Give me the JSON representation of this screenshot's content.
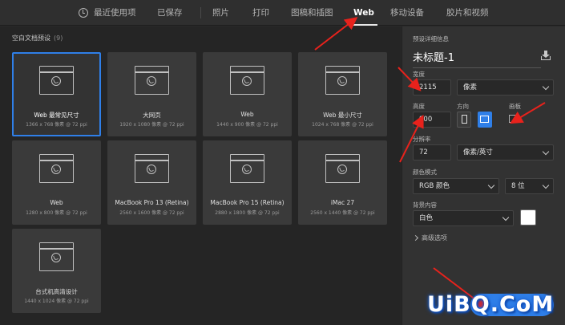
{
  "tabs": [
    {
      "label": "最近使用项",
      "active": false
    },
    {
      "label": "已保存",
      "active": false
    },
    {
      "label": "照片",
      "active": false
    },
    {
      "label": "打印",
      "active": false
    },
    {
      "label": "图稿和插图",
      "active": false
    },
    {
      "label": "Web",
      "active": true
    },
    {
      "label": "移动设备",
      "active": false
    },
    {
      "label": "胶片和视频",
      "active": false
    }
  ],
  "presets": {
    "title": "空白文档预设",
    "count": "(9)",
    "items": [
      {
        "name": "Web 最常见尺寸",
        "size": "1366 x 768 像素 @ 72 ppi",
        "selected": true,
        "icon": "web-globe-icon"
      },
      {
        "name": "大网页",
        "size": "1920 x 1080 像素 @ 72 ppi",
        "selected": false,
        "icon": "web-globe-icon"
      },
      {
        "name": "Web",
        "size": "1440 x 900 像素 @ 72 ppi",
        "selected": false,
        "icon": "web-globe-icon"
      },
      {
        "name": "Web 最小尺寸",
        "size": "1024 x 768 像素 @ 72 ppi",
        "selected": false,
        "icon": "web-globe-icon"
      },
      {
        "name": "Web",
        "size": "1280 x 800 像素 @ 72 ppi",
        "selected": false,
        "icon": "web-globe-icon"
      },
      {
        "name": "MacBook Pro 13 (Retina)",
        "size": "2560 x 1600 像素 @ 72 ppi",
        "selected": false,
        "icon": "web-globe-icon"
      },
      {
        "name": "MacBook Pro 15 (Retina)",
        "size": "2880 x 1800 像素 @ 72 ppi",
        "selected": false,
        "icon": "web-globe-icon"
      },
      {
        "name": "iMac 27",
        "size": "2560 x 1440 像素 @ 72 ppi",
        "selected": false,
        "icon": "web-globe-icon"
      },
      {
        "name": "台式机高清设计",
        "size": "1440 x 1024 像素 @ 72 ppi",
        "selected": false,
        "icon": "web-globe-icon"
      }
    ]
  },
  "details": {
    "heading": "预设详细信息",
    "doc_title": "未标题-1",
    "width_label": "宽度",
    "width_value": "2115",
    "width_unit": "像素",
    "height_label": "高度",
    "height_value": "900",
    "orientation_label": "方向",
    "artboard_label": "画板",
    "resolution_label": "分辨率",
    "resolution_value": "72",
    "resolution_unit": "像素/英寸",
    "color_mode_label": "颜色模式",
    "color_mode_value": "RGB 颜色",
    "bit_depth_value": "8 位",
    "background_label": "背景内容",
    "background_value": "白色",
    "background_swatch": "#ffffff",
    "advanced_label": "高级选项"
  },
  "watermark": "UiBQ.CoM",
  "colors": {
    "accent": "#2f7fe8",
    "annotation": "#e8221c"
  }
}
